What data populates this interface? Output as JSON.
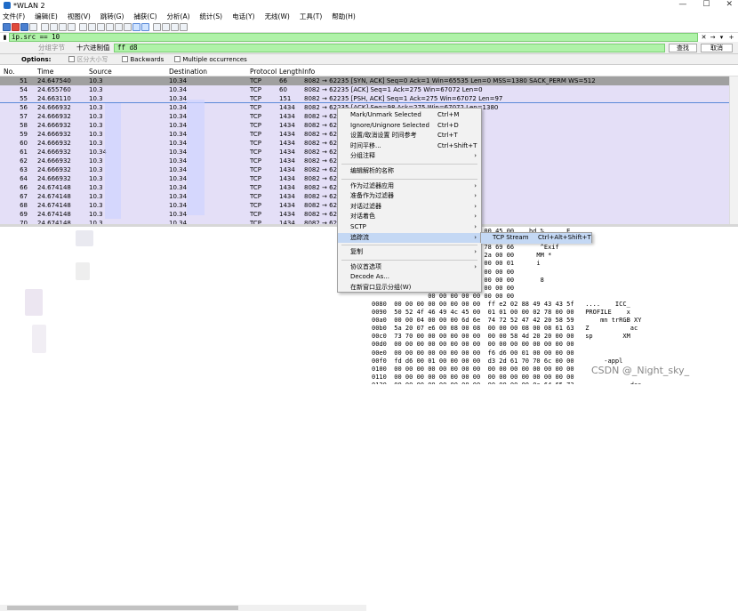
{
  "window": {
    "title": "*WLAN 2",
    "controls": [
      "—",
      "☐",
      "✕"
    ]
  },
  "menu": [
    "文件(F)",
    "编辑(E)",
    "视图(V)",
    "跳转(G)",
    "捕获(C)",
    "分析(A)",
    "统计(S)",
    "电话(Y)",
    "无线(W)",
    "工具(T)",
    "帮助(H)"
  ],
  "filter": {
    "value": "ip.src == 10",
    "clear": "✕",
    "arrow": "→",
    "dropdown": "▾",
    "add": "+"
  },
  "find": {
    "search_in": "分组字节流",
    "search_type": "十六进制值",
    "value": "ff d8",
    "find_button": "查找",
    "cancel_button": "取消"
  },
  "options": {
    "label": "Options:",
    "case": "区分大小写",
    "backwards": "Backwards",
    "multiple": "Multiple occurrences"
  },
  "columns": [
    "No.",
    "Time",
    "Source",
    "Destination",
    "Protocol",
    "Length",
    "Info"
  ],
  "packets": [
    {
      "no": "51",
      "time": "24.647540",
      "src": "10.3",
      "dst": "10.34",
      "proto": "TCP",
      "len": "66",
      "info": "8082 → 62235 [SYN, ACK] Seq=0 Ack=1 Win=65535 Len=0 MSS=1380 SACK_PERM WS=512"
    },
    {
      "no": "54",
      "time": "24.655760",
      "src": "10.3",
      "dst": "10.34",
      "proto": "TCP",
      "len": "60",
      "info": "8082 → 62235 [ACK] Seq=1 Ack=275 Win=67072 Len=0"
    },
    {
      "no": "55",
      "time": "24.663110",
      "src": "10.3",
      "dst": "10.34",
      "proto": "TCP",
      "len": "151",
      "info": "8082 → 62235 [PSH, ACK] Seq=1 Ack=275 Win=67072 Len=97"
    },
    {
      "no": "56",
      "time": "24.666932",
      "src": "10.3",
      "dst": "10.34",
      "proto": "TCP",
      "len": "1434",
      "info": "8082 → 62235 [ACK] Seq=98 Ack=275 Win=67072 Len=1380"
    },
    {
      "no": "57",
      "time": "24.666932",
      "src": "10.3",
      "dst": "10.34",
      "proto": "TCP",
      "len": "1434",
      "info": "8082 → 622                                Len=1380"
    },
    {
      "no": "58",
      "time": "24.666932",
      "src": "10.3",
      "dst": "10.34",
      "proto": "TCP",
      "len": "1434",
      "info": "8082 → 622                                =1380"
    },
    {
      "no": "59",
      "time": "24.666932",
      "src": "10.3",
      "dst": "10.34",
      "proto": "TCP",
      "len": "1434",
      "info": "8082 → 622                                n=1380"
    },
    {
      "no": "60",
      "time": "24.666932",
      "src": "10.3",
      "dst": "10.34",
      "proto": "TCP",
      "len": "1434",
      "info": "8082 → 622                                n=1380"
    },
    {
      "no": "61",
      "time": "24.666932",
      "src": "10.34",
      "dst": "10.34",
      "proto": "TCP",
      "len": "1434",
      "info": "8082 → 622                                n=1380"
    },
    {
      "no": "62",
      "time": "24.666932",
      "src": "10.3",
      "dst": "10.34",
      "proto": "TCP",
      "len": "1434",
      "info": "8082 → 622                                n=1380"
    },
    {
      "no": "63",
      "time": "24.666932",
      "src": "10.3",
      "dst": "10.34",
      "proto": "TCP",
      "len": "1434",
      "info": "8082 → 622                                n=1380"
    },
    {
      "no": "64",
      "time": "24.666932",
      "src": "10.3",
      "dst": "10.34",
      "proto": "TCP",
      "len": "1434",
      "info": "8082 → 622                                n=1380"
    },
    {
      "no": "66",
      "time": "24.674148",
      "src": "10.3",
      "dst": "10.34",
      "proto": "TCP",
      "len": "1434",
      "info": "8082 → 622                                n=1380"
    },
    {
      "no": "67",
      "time": "24.674148",
      "src": "10.3",
      "dst": "10.34",
      "proto": "TCP",
      "len": "1434",
      "info": "8082 → 622                                n=1380"
    },
    {
      "no": "68",
      "time": "24.674148",
      "src": "10.3",
      "dst": "10.34",
      "proto": "TCP",
      "len": "1434",
      "info": "8082 → 622                                n=1380"
    },
    {
      "no": "69",
      "time": "24.674148",
      "src": "10.3",
      "dst": "10.34",
      "proto": "TCP",
      "len": "1434",
      "info": "8082 → 622                                n=1380"
    },
    {
      "no": "70",
      "time": "24.674148",
      "src": "10.3",
      "dst": "10.34",
      "proto": "TCP",
      "len": "1434",
      "info": "8082 → 622                                Len=1380"
    }
  ],
  "context_menu": [
    {
      "label": "Mark/Unmark Selected",
      "shortcut": "Ctrl+M"
    },
    {
      "label": "Ignore/Unignore Selected",
      "shortcut": "Ctrl+D"
    },
    {
      "label": "设置/取消设置 时间参考",
      "shortcut": "Ctrl+T"
    },
    {
      "label": "时间平移...",
      "shortcut": "Ctrl+Shift+T"
    },
    {
      "label": "分组注释",
      "arrow": "›"
    },
    {
      "label": "编辑解析的名称"
    },
    {
      "label": "作为过滤器应用",
      "arrow": "›"
    },
    {
      "label": "准备作为过滤器",
      "arrow": "›"
    },
    {
      "label": "对话过滤器",
      "arrow": "›"
    },
    {
      "label": "对话着色",
      "arrow": "›"
    },
    {
      "label": "SCTP",
      "arrow": "›"
    },
    {
      "label": "追踪流",
      "arrow": "›"
    },
    {
      "label": "复制",
      "arrow": "›"
    },
    {
      "label": "协议首选项",
      "arrow": "›"
    },
    {
      "label": "Decode As..."
    },
    {
      "label": "在新窗口显示分组(W)"
    }
  ],
  "submenu": {
    "label": "TCP Stream",
    "shortcut": "Ctrl+Alt+Shift+T"
  },
  "hex_lines": [
    "               fb 19 9e 98 08 00 45 00   .hd %      E",
    "               00 33 1f 70 65 33 50 18    t      3 pe3P",
    "               ff e1 00 5e 45 78 69 66       ^Exif",
    "               00 00 4d 4d 00 2a 00 00      MM *",
    "               87 69 00 04 00 00 00 01      i",
    "               00 00 00 00 00 00 00 00",
    "               00 00 00 38 00 00 00 00       8",
    "               00 00 00 00 00 00 00 00",
    "               00 00 00 00 00 00 00 00",
    "0080  00 00 00 00 00 00 00 00  ff e2 02 88 49 43 43 5f   ....    ICC_",
    "0090  50 52 4f 46 49 4c 45 00  01 01 00 00 02 78 00 00   PROFILE    x",
    "00a0  00 00 04 00 00 00 6d 6e  74 72 52 47 42 20 58 59       mn trRGB XY",
    "00b0  5a 20 07 e6 00 08 00 08  00 00 00 08 00 08 61 63   Z           ac",
    "00c0  73 70 00 00 00 00 00 00  00 00 58 4d 20 20 00 00   sp        XM",
    "00d0  00 00 00 00 00 00 00 00  00 00 00 00 00 00 00 00",
    "00e0  00 00 00 00 00 00 00 00  f6 d6 00 01 00 00 00 00   ",
    "00f0  fd d6 00 01 00 00 00 00  d3 2d 61 70 70 6c 00 00        -appl",
    "0100  00 00 00 00 00 00 00 00  00 00 00 00 00 00 00 00",
    "0110  00 00 00 00 00 00 00 00  00 00 00 00 00 00 00 00",
    "0120  00 00 00 00 00 00 00 00  00 00 00 00 0a 64 65 73               des",
    "0130  63 00 00 00 fc 00 00 00  00 65 63 70 72 74 00 00   c     ecprt"
  ],
  "watermark": "CSDN @_Night_sky_",
  "colors": {
    "filter_green": "#aff2a8",
    "row_tcp": "#e4dff7",
    "row_dark": "#a0a0a0",
    "menu_highlight": "#c4d8f4"
  },
  "icons": [
    "shark-fin-icon",
    "stop-icon",
    "restart-icon",
    "options-icon",
    "open-icon",
    "save-icon",
    "close-icon",
    "reload-icon",
    "find-icon",
    "back-icon",
    "forward-icon",
    "goto-icon",
    "first-icon",
    "last-icon",
    "autoscroll-icon",
    "colorize-icon",
    "zoom-in-icon",
    "zoom-out-icon",
    "zoom-reset-icon",
    "resize-columns-icon"
  ]
}
